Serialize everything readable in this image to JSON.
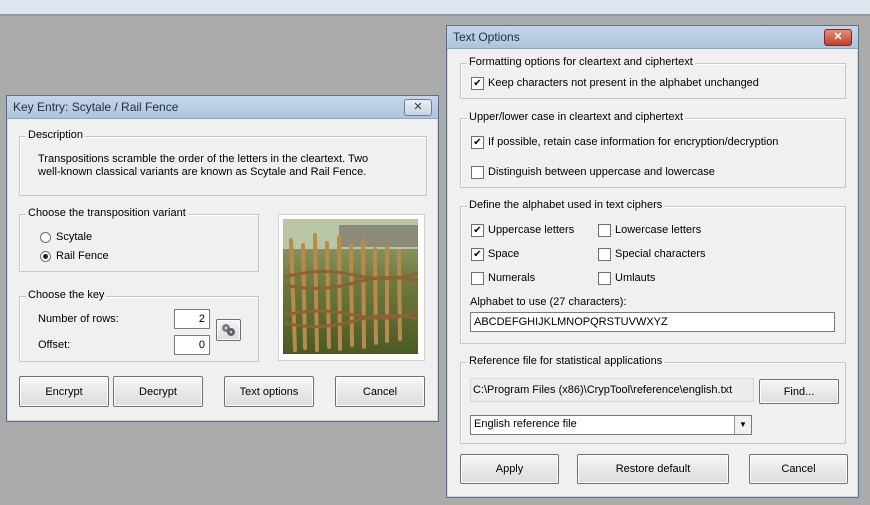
{
  "key_entry": {
    "title": "Key Entry: Scytale / Rail Fence",
    "close_glyph": "✕",
    "description": {
      "legend": "Description",
      "line1": "Transpositions scramble the order of the letters in the cleartext. Two",
      "line2": "well-known classical variants are known as Scytale and Rail Fence."
    },
    "variant": {
      "legend": "Choose the transposition variant",
      "options": [
        "Scytale",
        "Rail Fence"
      ],
      "selected": "Rail Fence"
    },
    "key": {
      "legend": "Choose the key",
      "rows_label": "Number of rows:",
      "rows_value": "2",
      "offset_label": "Offset:",
      "offset_value": "0"
    },
    "buttons": {
      "encrypt": "Encrypt",
      "decrypt": "Decrypt",
      "text_options": "Text options",
      "cancel": "Cancel"
    }
  },
  "text_options": {
    "title": "Text Options",
    "close_glyph": "✕",
    "formatting": {
      "legend": "Formatting options for cleartext and ciphertext",
      "keep_label": "Keep characters not present in the alphabet unchanged",
      "keep_checked": true
    },
    "case": {
      "legend": "Upper/lower case in cleartext and ciphertext",
      "retain_label": "If possible, retain case information for encryption/decryption",
      "retain_checked": true,
      "distinguish_label": "Distinguish between uppercase and lowercase",
      "distinguish_checked": false
    },
    "alphabet": {
      "legend": "Define the alphabet used in text ciphers",
      "uppercase_label": "Uppercase letters",
      "uppercase_checked": true,
      "lowercase_label": "Lowercase letters",
      "lowercase_checked": false,
      "space_label": "Space",
      "space_checked": true,
      "special_label": "Special characters",
      "special_checked": false,
      "numerals_label": "Numerals",
      "numerals_checked": false,
      "umlauts_label": "Umlauts",
      "umlauts_checked": false,
      "alphabet_label": "Alphabet to use (27 characters):",
      "alphabet_value": "ABCDEFGHIJKLMNOPQRSTUVWXYZ"
    },
    "reference": {
      "legend": "Reference file for statistical applications",
      "path": "C:\\Program Files (x86)\\CrypTool\\reference\\english.txt",
      "find_button": "Find...",
      "selected_file": "English reference file"
    },
    "buttons": {
      "apply": "Apply",
      "restore": "Restore default",
      "cancel": "Cancel"
    }
  }
}
